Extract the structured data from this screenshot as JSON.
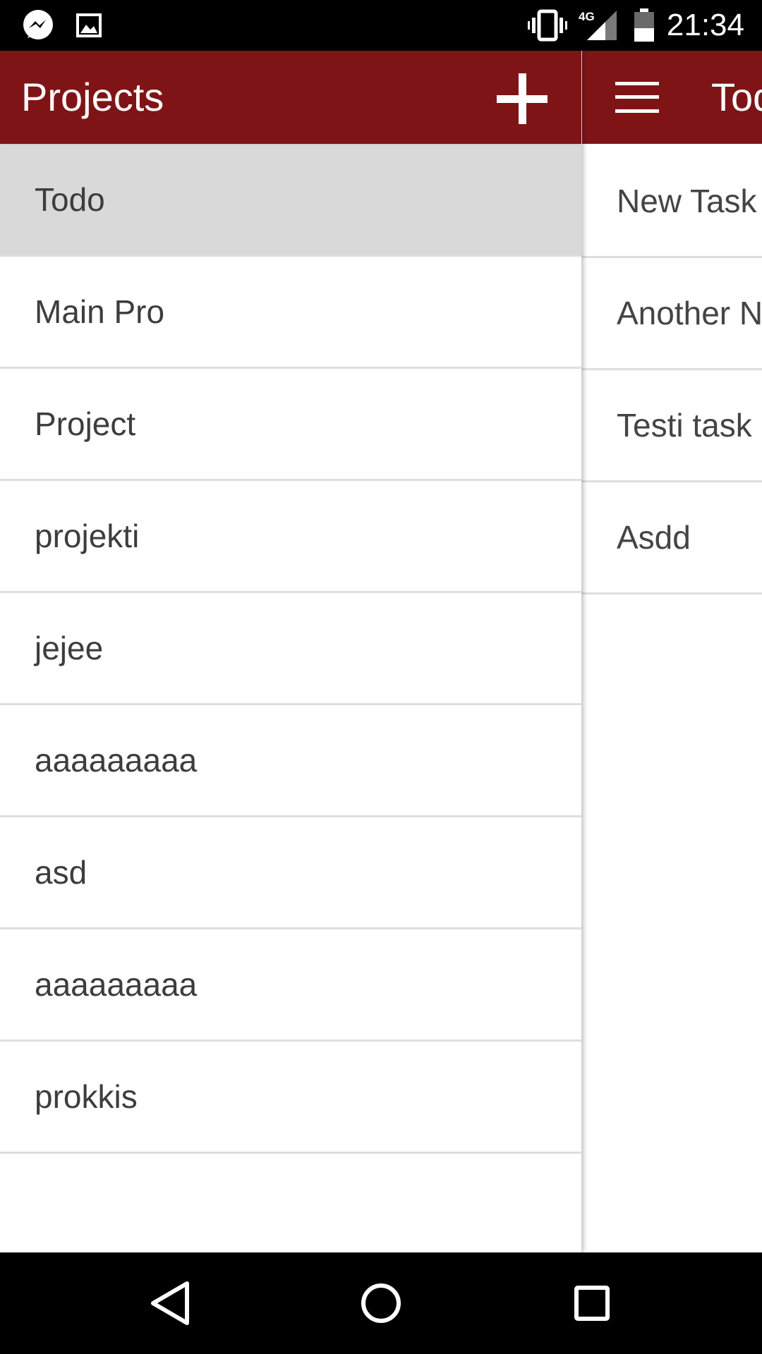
{
  "status_bar": {
    "time": "21:34",
    "network": "4G",
    "icons": [
      "messenger-icon",
      "image-icon",
      "vibrate-icon",
      "signal-icon",
      "battery-icon"
    ]
  },
  "drawer": {
    "title": "Projects",
    "add_icon": "plus-icon",
    "projects": [
      {
        "label": "Todo",
        "selected": true
      },
      {
        "label": "Main Pro"
      },
      {
        "label": "Project"
      },
      {
        "label": "projekti"
      },
      {
        "label": "jejee"
      },
      {
        "label": "aaaaaaaaa"
      },
      {
        "label": "asd"
      },
      {
        "label": "aaaaaaaaa"
      },
      {
        "label": "prokkis"
      }
    ]
  },
  "main": {
    "title": "Todo",
    "menu_icon": "hamburger-menu-icon",
    "tasks": [
      "New Task",
      "Another New Task",
      "Testi task",
      "Asdd"
    ]
  },
  "nav_bar": {
    "icons": [
      "back-icon",
      "home-icon",
      "recents-icon"
    ]
  },
  "colors": {
    "toolbar": "#7f1416",
    "selected_row": "#d9d9d9",
    "divider": "#dedede"
  }
}
